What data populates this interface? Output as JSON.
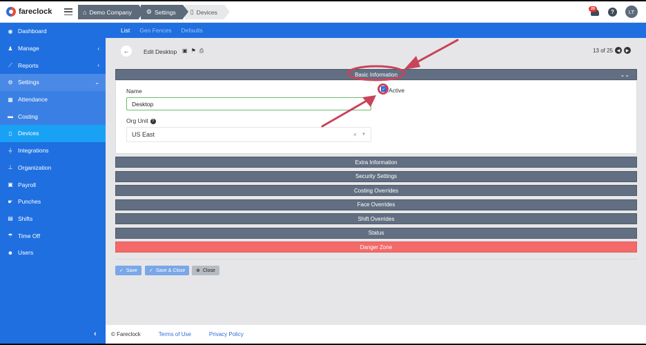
{
  "app": {
    "logo_text": "fareclock"
  },
  "breadcrumb": [
    "Demo Company",
    "Settings",
    "Devices"
  ],
  "header": {
    "notification_count": "20",
    "help_label": "?",
    "avatar_initials": "LT"
  },
  "sidebar": {
    "items": [
      {
        "label": "Dashboard",
        "icon": "dashboard-icon"
      },
      {
        "label": "Manage",
        "icon": "person-icon",
        "chevron": "‹"
      },
      {
        "label": "Reports",
        "icon": "chart-icon",
        "chevron": "‹"
      },
      {
        "label": "Settings",
        "icon": "gear-icon",
        "chevron": "⌄"
      },
      {
        "label": "Attendance",
        "icon": "attendance-icon"
      },
      {
        "label": "Costing",
        "icon": "briefcase-icon"
      },
      {
        "label": "Devices",
        "icon": "tablet-icon"
      },
      {
        "label": "Integrations",
        "icon": "plug-icon"
      },
      {
        "label": "Organization",
        "icon": "sitemap-icon"
      },
      {
        "label": "Payroll",
        "icon": "money-icon"
      },
      {
        "label": "Punches",
        "icon": "punch-icon"
      },
      {
        "label": "Shifts",
        "icon": "calendar-icon"
      },
      {
        "label": "Time Off",
        "icon": "umbrella-icon"
      },
      {
        "label": "Users",
        "icon": "users-icon"
      }
    ],
    "collapse": "‹"
  },
  "tabs": [
    "List",
    "Geo Fences",
    "Defaults"
  ],
  "toolbar": {
    "title": "Edit Desktop",
    "pager": "13 of 25"
  },
  "form": {
    "section_basic": "Basic Information",
    "name_label": "Name",
    "name_value": "Desktop",
    "active_label": "Active",
    "org_unit_label": "Org Unit",
    "org_unit_value": "US East",
    "clear": "×",
    "help": "?"
  },
  "sections": [
    "Extra Information",
    "Security Settings",
    "Costing Overrides",
    "Face Overrides",
    "Shift Overrides",
    "Status",
    "Danger Zone"
  ],
  "buttons": {
    "save": "Save",
    "save_close": "Save & Close",
    "close": "Close"
  },
  "footer": {
    "copyright": "© Fareclock",
    "terms": "Terms of Use",
    "privacy": "Privacy Policy"
  },
  "colors": {
    "sidebar": "#1f6fe0",
    "active": "#19a2f5",
    "section": "#626f82",
    "danger": "#f46a6a",
    "annotation": "#c9435a"
  }
}
